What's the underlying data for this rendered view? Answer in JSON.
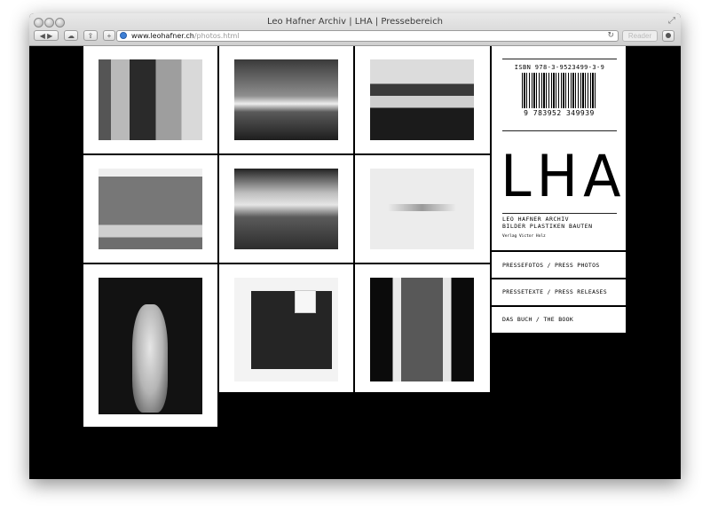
{
  "window": {
    "title": "Leo Hafner Archiv | LHA | Pressebereich"
  },
  "toolbar": {
    "url_domain": "www.leohafner.ch",
    "url_path": "/photos.html",
    "reader_label": "Reader"
  },
  "book_panel": {
    "isbn": "ISBN 978-3-9523499-3-9",
    "barcode_number": "9 783952 349939",
    "logo": "LHA",
    "archive_line1": "LEO HAFNER ARCHIV",
    "archive_line2": "BILDER PLASTIKEN BAUTEN",
    "publisher": "Verlag Victor Holz"
  },
  "menu": {
    "press_photos": "PRESSEFOTOS / PRESS PHOTOS",
    "press_releases": "PRESSETEXTE / PRESS RELEASES",
    "book": "DAS BUCH / THE BOOK"
  },
  "photos": [
    {
      "icon": "building-photo"
    },
    {
      "icon": "building-photo"
    },
    {
      "icon": "interior-photo"
    },
    {
      "icon": "building-photo"
    },
    {
      "icon": "building-photo"
    },
    {
      "icon": "drawing-photo"
    },
    {
      "icon": "sculpture-photo"
    },
    {
      "icon": "book-photo"
    },
    {
      "icon": "hall-photo"
    }
  ]
}
